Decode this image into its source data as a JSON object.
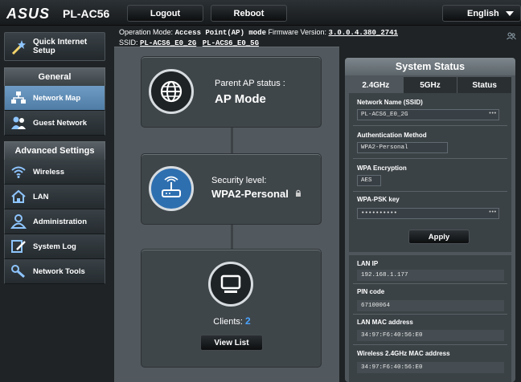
{
  "header": {
    "brand": "ASUS",
    "model": "PL-AC56",
    "logout_label": "Logout",
    "reboot_label": "Reboot",
    "language": "English"
  },
  "info": {
    "op_mode_label": "Operation Mode:",
    "op_mode_value": "Access Point(AP) mode",
    "fw_label": "Firmware Version:",
    "fw_value": "3.0.0.4.380_2741",
    "ssid_label": "SSID:",
    "ssid_2g": "PL-ACS6_E0_2G",
    "ssid_5g": "PL-ACS6_E0_5G"
  },
  "sidebar": {
    "quick_setup": "Quick Internet Setup",
    "general_title": "General",
    "general_items": [
      {
        "label": "Network Map"
      },
      {
        "label": "Guest Network"
      }
    ],
    "advanced_title": "Advanced Settings",
    "advanced_items": [
      {
        "label": "Wireless"
      },
      {
        "label": "LAN"
      },
      {
        "label": "Administration"
      },
      {
        "label": "System Log"
      },
      {
        "label": "Network Tools"
      }
    ]
  },
  "map": {
    "ap_status_label": "Parent AP status :",
    "ap_status_value": "AP Mode",
    "security_label": "Security level:",
    "security_value": "WPA2-Personal",
    "clients_label": "Clients:",
    "clients_count": "2",
    "view_list_label": "View List"
  },
  "status": {
    "title": "System Status",
    "tabs": [
      "2.4GHz",
      "5GHz",
      "Status"
    ],
    "ssid_label": "Network Name (SSID)",
    "ssid_value": "PL-ACS6_E0_2G",
    "auth_label": "Authentication Method",
    "auth_value": "WPA2-Personal",
    "enc_label": "WPA Encryption",
    "enc_value": "AES",
    "psk_label": "WPA-PSK key",
    "psk_value": "••••••••••",
    "apply_label": "Apply",
    "lan_ip_label": "LAN IP",
    "lan_ip_value": "192.168.1.177",
    "pin_label": "PIN code",
    "pin_value": "67100064",
    "lan_mac_label": "LAN MAC address",
    "lan_mac_value": "34:97:F6:40:56:E0",
    "wl_mac_label": "Wireless 2.4GHz MAC address",
    "wl_mac_value": "34:97:F6:40:56:E0"
  },
  "colors": {
    "active_nav": "#5f8cb5",
    "accent_blue": "#2e6fb0",
    "client_count": "#4aa3ff"
  }
}
